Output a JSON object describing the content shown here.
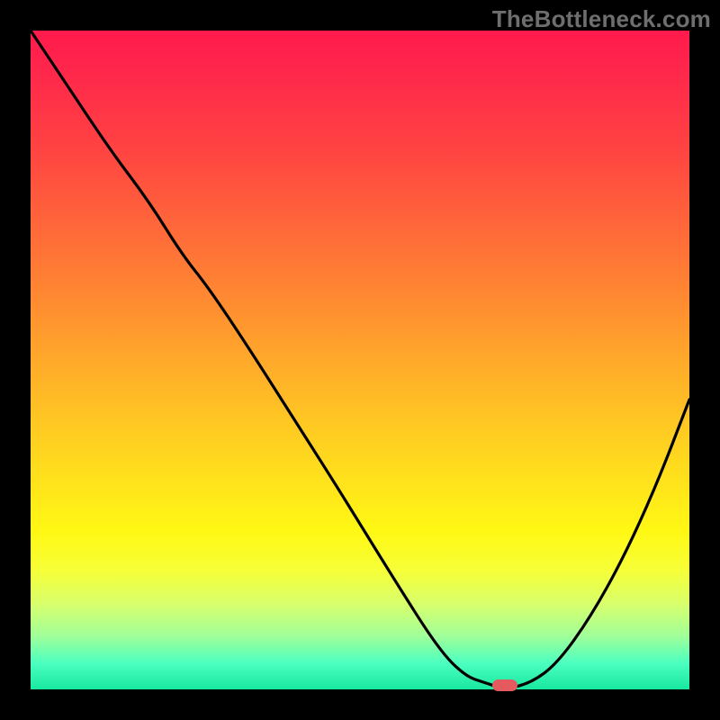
{
  "watermark": "TheBottleneck.com",
  "colors": {
    "frame": "#000000",
    "curve": "#000000",
    "marker": "#e55a5f"
  },
  "chart_data": {
    "type": "line",
    "title": "",
    "xlabel": "",
    "ylabel": "",
    "xlim": [
      0,
      100
    ],
    "ylim": [
      0,
      100
    ],
    "grid": false,
    "legend": false,
    "note": "No tick labels visible; values are normalized 0–100 based on plot frame.",
    "series": [
      {
        "name": "curve",
        "x": [
          0,
          6,
          12,
          18,
          23,
          27,
          33,
          40,
          47,
          55,
          62,
          66,
          69,
          72,
          76,
          80,
          85,
          90,
          95,
          100
        ],
        "y": [
          100,
          91,
          82,
          74,
          66,
          61,
          52,
          41,
          30,
          17,
          6,
          2,
          1,
          0,
          1,
          4,
          11,
          20,
          31,
          44
        ]
      }
    ],
    "markers": [
      {
        "name": "optimal-point",
        "x": 72,
        "y": 0.5
      }
    ],
    "background_gradient_stops": [
      {
        "pos": 0,
        "color": "#ff1a4d"
      },
      {
        "pos": 50,
        "color": "#ffb127"
      },
      {
        "pos": 78,
        "color": "#fff814"
      },
      {
        "pos": 100,
        "color": "#18e8a0"
      }
    ]
  }
}
